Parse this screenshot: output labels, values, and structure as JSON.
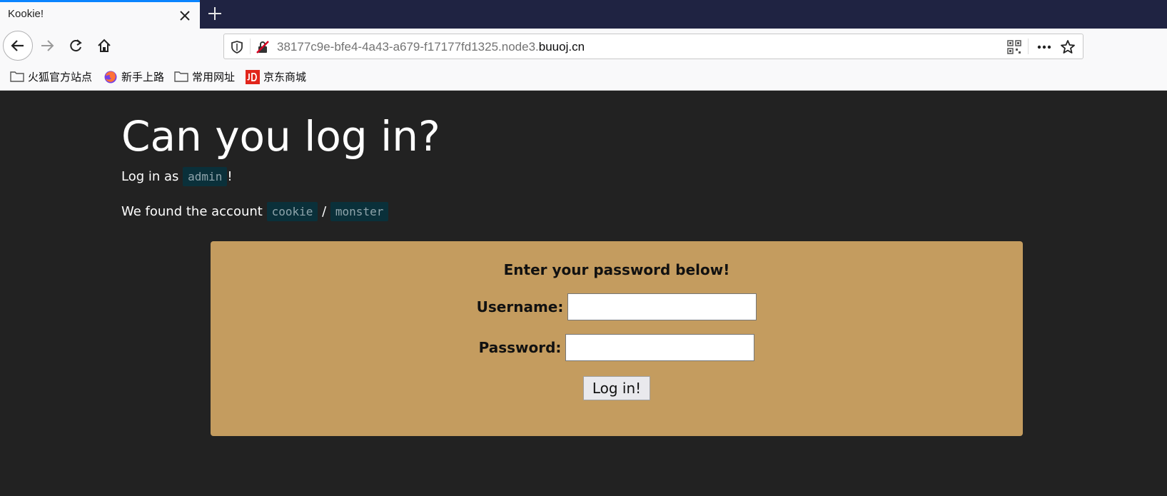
{
  "browser": {
    "tab": {
      "title": "Kookie!"
    },
    "url": {
      "host_prefix": "38177c9e-bfe4-4a43-a679-f17177fd1325.node3.",
      "domain": "buuoj.cn"
    },
    "bookmarks": [
      {
        "label": "火狐官方站点",
        "icon": "folder-icon"
      },
      {
        "label": "新手上路",
        "icon": "firefox-icon"
      },
      {
        "label": "常用网址",
        "icon": "folder-icon"
      },
      {
        "label": "京东商城",
        "icon": "jd-icon"
      }
    ]
  },
  "page": {
    "title": "Can you log in?",
    "line1_prefix": "Log in as",
    "line1_user": "admin",
    "line1_suffix": "!",
    "line2_prefix": "We found the account",
    "line2_user": "cookie",
    "line2_sep": "/",
    "line2_pass": "monster"
  },
  "form": {
    "heading": "Enter your password below!",
    "username_label": "Username:",
    "username_value": "",
    "password_label": "Password:",
    "password_value": "",
    "submit_label": "Log in!"
  },
  "colors": {
    "tabbar": "#1f2342",
    "page_bg": "#222222",
    "login_box": "#c49c5f",
    "code_bg": "#0a303a",
    "accent": "#0a84ff"
  }
}
